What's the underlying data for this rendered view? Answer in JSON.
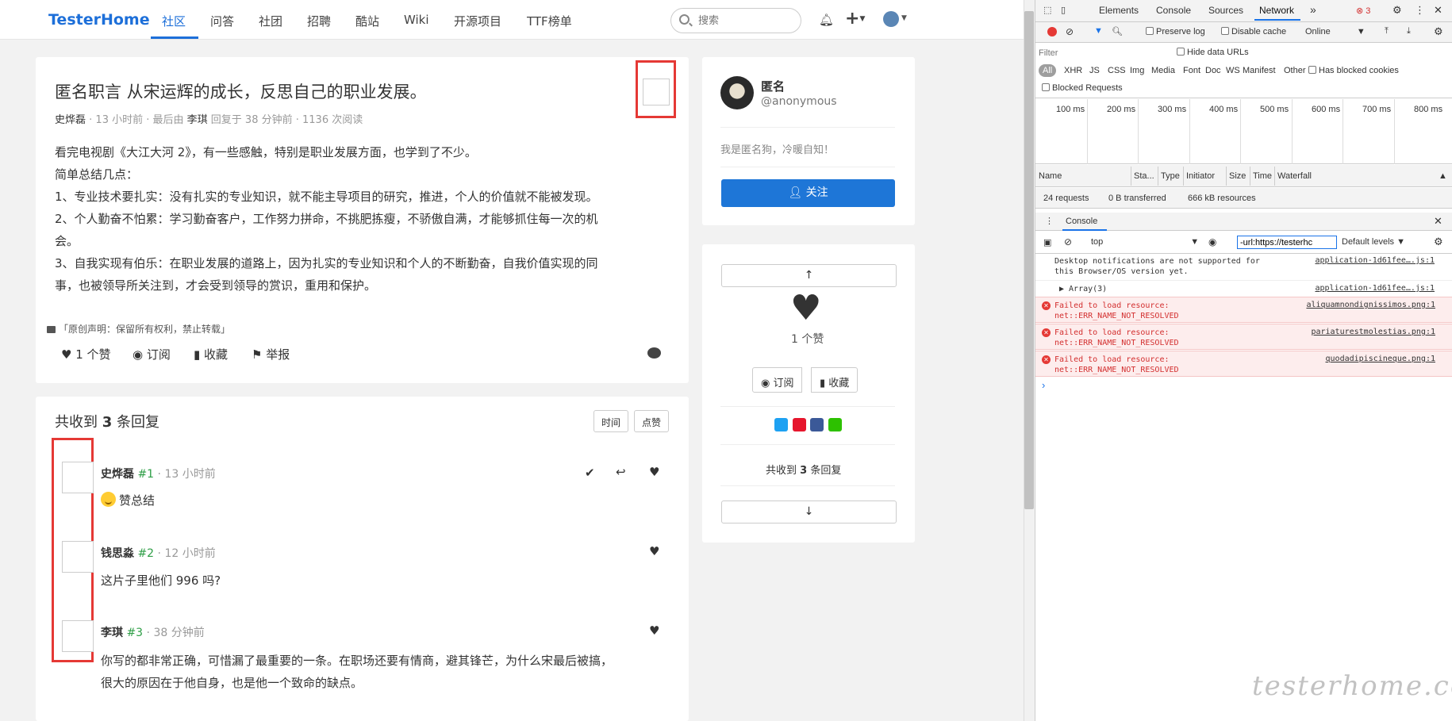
{
  "nav": {
    "brand": "TesterHome",
    "items": [
      "社区",
      "问答",
      "社团",
      "招聘",
      "酷站",
      "Wiki",
      "开源项目",
      "TTF榜单"
    ],
    "search_placeholder": "搜索",
    "icons": [
      "bell-icon",
      "plus-icon",
      "user-avatar"
    ]
  },
  "topic": {
    "title": "匿名职言 从宋运辉的成长，反思自己的职业发展。",
    "author": "史烨磊",
    "meta_time": "· 13 小时前 · 最后由",
    "last_replier": "李琪",
    "meta_rest": "回复于 38 分钟前 · 1136 次阅读",
    "body": [
      "看完电视剧《大江大河 2》，有一些感触，特别是职业发展方面，也学到了不少。",
      "简单总结几点：",
      "1、专业技术要扎实：没有扎实的专业知识，就不能主导项目的研究，推进，个人的价值就不能被发现。",
      "2、个人勤奋不怕累：学习勤奋客户，工作努力拼命，不挑肥拣瘦，不骄傲自满，才能够抓住每一次的机",
      "会。",
      "3、自我实现有伯乐：在职业发展的道路上，因为扎实的专业知识和个人的不断勤奋，自我价值实现的同",
      "事，也被领导所关注到，才会受到领导的赏识，重用和保护。"
    ],
    "license": "「原创声明：保留所有权利，禁止转载」",
    "actions": {
      "like": "♥ 1 个赞",
      "subscribe": "◉ 订阅",
      "bookmark": "▮ 收藏",
      "report": "⚑ 举报"
    }
  },
  "replies": {
    "title_prefix": "共收到",
    "count": "3",
    "title_suffix": "条回复",
    "sort_time": "时间",
    "sort_likes": "点赞",
    "items": [
      {
        "author": "史烨磊",
        "floor": "#1",
        "time": "· 13 小时前",
        "body": "赞总结"
      },
      {
        "author": "钱思淼",
        "floor": "#2",
        "time": "· 12 小时前",
        "body": "这片子里他们 996 吗?"
      },
      {
        "author": "李琪",
        "floor": "#3",
        "time": "· 38 分钟前",
        "body": "你写的都非常正确，可惜漏了最重要的一条。在职场还要有情商，避其锋芒，为什么宋最后被搞，",
        "body2": "很大的原因在于他自身，也是他一个致命的缺点。"
      }
    ]
  },
  "sidebar": {
    "name": "匿名",
    "handle": "@anonymous",
    "motto": "我是匿名狗，冷暖自知！",
    "follow": "关注",
    "up": "↑",
    "likes": "1 个赞",
    "subscribe": "◉ 订阅",
    "bookmark": "▮ 收藏",
    "replies_prefix": "共收到",
    "replies_count": "3",
    "replies_suffix": "条回复",
    "down": "↓"
  },
  "watermark": "testerhome.com",
  "devtools": {
    "tabs": [
      "Elements",
      "Console",
      "Sources",
      "Network"
    ],
    "more": "»",
    "error_count": "3",
    "preserve_log": "Preserve log",
    "disable_cache": "Disable cache",
    "throttle": "Online",
    "filter_placeholder": "Filter",
    "hide_data_urls": "Hide data URLs",
    "types": [
      "All",
      "XHR",
      "JS",
      "CSS",
      "Img",
      "Media",
      "Font",
      "Doc",
      "WS",
      "Manifest",
      "Other"
    ],
    "has_blocked_cookies": "Has blocked cookies",
    "blocked_requests": "Blocked Requests",
    "timeline_ticks": [
      "100 ms",
      "200 ms",
      "300 ms",
      "400 ms",
      "500 ms",
      "600 ms",
      "700 ms",
      "800 ms"
    ],
    "columns": [
      "Name",
      "Sta...",
      "Type",
      "Initiator",
      "Size",
      "Time",
      "Waterfall"
    ],
    "summary": [
      "24 requests",
      "0 B transferred",
      "666 kB resources"
    ],
    "console_title": "Console",
    "context": "top",
    "console_filter": "-url:https://testerhc",
    "levels": "Default levels",
    "messages": [
      {
        "text": "Desktop notifications are not supported for\nthis Browser/OS version yet.",
        "src": "application-1d61fee….js:1",
        "error": false
      },
      {
        "text": "▶ Array(3)",
        "src": "application-1d61fee….js:1",
        "error": false
      },
      {
        "text": "Failed to load resource:\nnet::ERR_NAME_NOT_RESOLVED",
        "src": "aliquamnondignissimos.png:1",
        "error": true
      },
      {
        "text": "Failed to load resource:\nnet::ERR_NAME_NOT_RESOLVED",
        "src": "pariaturestmolestias.png:1",
        "error": true
      },
      {
        "text": "Failed to load resource:\nnet::ERR_NAME_NOT_RESOLVED",
        "src": "quodadipiscineque.png:1",
        "error": true
      }
    ],
    "prompt": "›"
  }
}
